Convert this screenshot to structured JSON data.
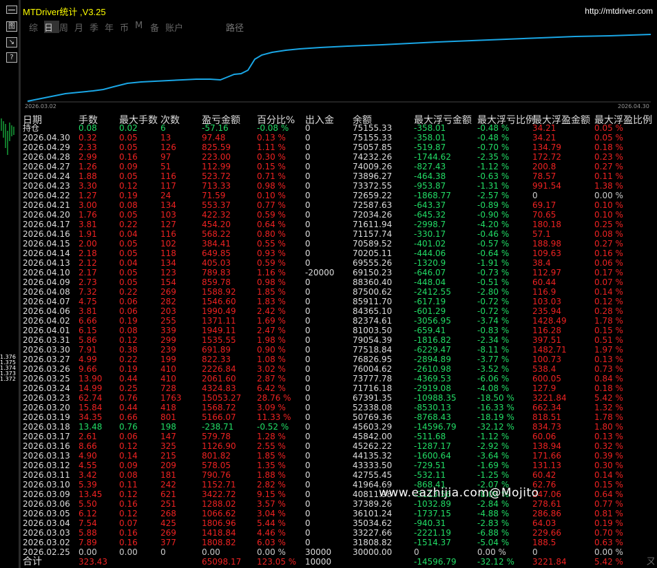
{
  "window": {
    "title": "MTDriver统计 ,V3.25",
    "url": "http://mtdriver.com"
  },
  "side_buttons": [
    "图",
    "↘",
    "?"
  ],
  "left_ticks": [
    "1.376",
    "1.375",
    "1.374",
    "1.373",
    "1.372"
  ],
  "tabs": [
    {
      "label": "综",
      "active": false
    },
    {
      "label": "日",
      "active": true
    },
    {
      "label": "周",
      "active": false
    },
    {
      "label": "月",
      "active": false
    },
    {
      "label": "季",
      "active": false
    },
    {
      "label": "年",
      "active": false
    },
    {
      "label": "币",
      "active": false
    },
    {
      "label": "M",
      "active": false
    },
    {
      "label": "备",
      "active": false
    },
    {
      "label": "账户",
      "active": false
    }
  ],
  "path_label": "路径",
  "curve": {
    "start_date": "2026.03.02",
    "end_date": "2026.04.30",
    "color": "#1aa7e6"
  },
  "headers": [
    "日期",
    "手数",
    "最大手数",
    "次数",
    "盈亏金额",
    "百分比%",
    "出入金",
    "余额",
    "最大浮亏金额",
    "最大浮亏比例",
    "最大浮盈金额",
    "最大浮盈比例"
  ],
  "rows": [
    {
      "date": "持仓",
      "lots": "0.08",
      "maxlots": "0.02",
      "trades": "6",
      "pnl": "-57.16",
      "pct": "-0.08 %",
      "io": "0",
      "bal": "75155.33",
      "fl": "-358.01",
      "flpct": "-0.48 %",
      "fp": "34.21",
      "fppct": "0.05 %"
    },
    {
      "date": "2026.04.30",
      "lots": "0.32",
      "maxlots": "0.05",
      "trades": "13",
      "pnl": "97.48",
      "pct": "0.13 %",
      "io": "0",
      "bal": "75155.33",
      "fl": "-358.01",
      "flpct": "-0.48 %",
      "fp": "34.21",
      "fppct": "0.05 %"
    },
    {
      "date": "2026.04.29",
      "lots": "2.33",
      "maxlots": "0.05",
      "trades": "126",
      "pnl": "825.59",
      "pct": "1.11 %",
      "io": "0",
      "bal": "75057.85",
      "fl": "-519.87",
      "flpct": "-0.70 %",
      "fp": "134.79",
      "fppct": "0.18 %"
    },
    {
      "date": "2026.04.28",
      "lots": "2.99",
      "maxlots": "0.16",
      "trades": "97",
      "pnl": "223.00",
      "pct": "0.30 %",
      "io": "0",
      "bal": "74232.26",
      "fl": "-1744.62",
      "flpct": "-2.35 %",
      "fp": "172.72",
      "fppct": "0.23 %"
    },
    {
      "date": "2026.04.27",
      "lots": "1.26",
      "maxlots": "0.09",
      "trades": "51",
      "pnl": "112.99",
      "pct": "0.15 %",
      "io": "0",
      "bal": "74009.26",
      "fl": "-827.43",
      "flpct": "-1.12 %",
      "fp": "200.8",
      "fppct": "0.27 %"
    },
    {
      "date": "2026.04.24",
      "lots": "1.88",
      "maxlots": "0.05",
      "trades": "116",
      "pnl": "523.72",
      "pct": "0.71 %",
      "io": "0",
      "bal": "73896.27",
      "fl": "-464.38",
      "flpct": "-0.63 %",
      "fp": "78.57",
      "fppct": "0.11 %"
    },
    {
      "date": "2026.04.23",
      "lots": "3.30",
      "maxlots": "0.12",
      "trades": "117",
      "pnl": "713.33",
      "pct": "0.98 %",
      "io": "0",
      "bal": "73372.55",
      "fl": "-953.87",
      "flpct": "-1.31 %",
      "fp": "991.54",
      "fppct": "1.38 %"
    },
    {
      "date": "2026.04.22",
      "lots": "1.27",
      "maxlots": "0.19",
      "trades": "24",
      "pnl": "71.59",
      "pct": "0.10 %",
      "io": "0",
      "bal": "72659.22",
      "fl": "-1868.77",
      "flpct": "-2.57 %",
      "fp": "0",
      "fppct": "0.00 %"
    },
    {
      "date": "2026.04.21",
      "lots": "3.00",
      "maxlots": "0.08",
      "trades": "134",
      "pnl": "553.37",
      "pct": "0.77 %",
      "io": "0",
      "bal": "72587.63",
      "fl": "-643.37",
      "flpct": "-0.89 %",
      "fp": "69.17",
      "fppct": "0.10 %"
    },
    {
      "date": "2026.04.20",
      "lots": "1.76",
      "maxlots": "0.05",
      "trades": "103",
      "pnl": "422.32",
      "pct": "0.59 %",
      "io": "0",
      "bal": "72034.26",
      "fl": "-645.32",
      "flpct": "-0.90 %",
      "fp": "70.65",
      "fppct": "0.10 %"
    },
    {
      "date": "2026.04.17",
      "lots": "3.81",
      "maxlots": "0.22",
      "trades": "127",
      "pnl": "454.20",
      "pct": "0.64 %",
      "io": "0",
      "bal": "71611.94",
      "fl": "-2998.7",
      "flpct": "-4.20 %",
      "fp": "180.18",
      "fppct": "0.25 %"
    },
    {
      "date": "2026.04.16",
      "lots": "1.91",
      "maxlots": "0.04",
      "trades": "116",
      "pnl": "568.22",
      "pct": "0.80 %",
      "io": "0",
      "bal": "71157.74",
      "fl": "-330.17",
      "flpct": "-0.46 %",
      "fp": "57.1",
      "fppct": "0.08 %"
    },
    {
      "date": "2026.04.15",
      "lots": "2.00",
      "maxlots": "0.05",
      "trades": "102",
      "pnl": "384.41",
      "pct": "0.55 %",
      "io": "0",
      "bal": "70589.52",
      "fl": "-401.02",
      "flpct": "-0.57 %",
      "fp": "188.98",
      "fppct": "0.27 %"
    },
    {
      "date": "2026.04.14",
      "lots": "2.18",
      "maxlots": "0.05",
      "trades": "118",
      "pnl": "649.85",
      "pct": "0.93 %",
      "io": "0",
      "bal": "70205.11",
      "fl": "-444.06",
      "flpct": "-0.64 %",
      "fp": "109.63",
      "fppct": "0.16 %"
    },
    {
      "date": "2026.04.13",
      "lots": "2.12",
      "maxlots": "0.04",
      "trades": "134",
      "pnl": "405.03",
      "pct": "0.59 %",
      "io": "0",
      "bal": "69555.26",
      "fl": "-1320.9",
      "flpct": "-1.91 %",
      "fp": "38.4",
      "fppct": "0.06 %"
    },
    {
      "date": "2026.04.10",
      "lots": "2.17",
      "maxlots": "0.05",
      "trades": "123",
      "pnl": "789.83",
      "pct": "1.16 %",
      "io": "-20000",
      "bal": "69150.23",
      "fl": "-646.07",
      "flpct": "-0.73 %",
      "fp": "112.97",
      "fppct": "0.17 %"
    },
    {
      "date": "2026.04.09",
      "lots": "2.73",
      "maxlots": "0.05",
      "trades": "154",
      "pnl": "859.78",
      "pct": "0.98 %",
      "io": "0",
      "bal": "88360.40",
      "fl": "-448.04",
      "flpct": "-0.51 %",
      "fp": "60.44",
      "fppct": "0.07 %"
    },
    {
      "date": "2026.04.08",
      "lots": "7.32",
      "maxlots": "0.22",
      "trades": "269",
      "pnl": "1588.92",
      "pct": "1.85 %",
      "io": "0",
      "bal": "87500.62",
      "fl": "-2412.55",
      "flpct": "-2.80 %",
      "fp": "116.9",
      "fppct": "0.14 %"
    },
    {
      "date": "2026.04.07",
      "lots": "4.75",
      "maxlots": "0.06",
      "trades": "282",
      "pnl": "1546.60",
      "pct": "1.83 %",
      "io": "0",
      "bal": "85911.70",
      "fl": "-617.19",
      "flpct": "-0.72 %",
      "fp": "103.03",
      "fppct": "0.12 %"
    },
    {
      "date": "2026.04.06",
      "lots": "3.81",
      "maxlots": "0.06",
      "trades": "203",
      "pnl": "1990.49",
      "pct": "2.42 %",
      "io": "0",
      "bal": "84365.10",
      "fl": "-601.29",
      "flpct": "-0.72 %",
      "fp": "235.94",
      "fppct": "0.28 %"
    },
    {
      "date": "2026.04.02",
      "lots": "6.66",
      "maxlots": "0.19",
      "trades": "255",
      "pnl": "1371.11",
      "pct": "1.69 %",
      "io": "0",
      "bal": "82374.61",
      "fl": "-3056.95",
      "flpct": "-3.74 %",
      "fp": "1428.49",
      "fppct": "1.78 %"
    },
    {
      "date": "2026.04.01",
      "lots": "6.15",
      "maxlots": "0.08",
      "trades": "339",
      "pnl": "1949.11",
      "pct": "2.47 %",
      "io": "0",
      "bal": "81003.50",
      "fl": "-659.41",
      "flpct": "-0.83 %",
      "fp": "116.28",
      "fppct": "0.15 %"
    },
    {
      "date": "2026.03.31",
      "lots": "5.86",
      "maxlots": "0.12",
      "trades": "299",
      "pnl": "1535.55",
      "pct": "1.98 %",
      "io": "0",
      "bal": "79054.39",
      "fl": "-1816.82",
      "flpct": "-2.34 %",
      "fp": "397.51",
      "fppct": "0.51 %"
    },
    {
      "date": "2026.03.30",
      "lots": "7.91",
      "maxlots": "0.38",
      "trades": "239",
      "pnl": "691.89",
      "pct": "0.90 %",
      "io": "0",
      "bal": "77518.84",
      "fl": "-6229.47",
      "flpct": "-8.11 %",
      "fp": "1482.71",
      "fppct": "1.97 %"
    },
    {
      "date": "2026.03.27",
      "lots": "4.99",
      "maxlots": "0.22",
      "trades": "199",
      "pnl": "822.33",
      "pct": "1.08 %",
      "io": "0",
      "bal": "76826.95",
      "fl": "-2894.89",
      "flpct": "-3.77 %",
      "fp": "100.73",
      "fppct": "0.13 %"
    },
    {
      "date": "2026.03.26",
      "lots": "9.66",
      "maxlots": "0.19",
      "trades": "410",
      "pnl": "2226.84",
      "pct": "3.02 %",
      "io": "0",
      "bal": "76004.62",
      "fl": "-2610.98",
      "flpct": "-3.52 %",
      "fp": "538.4",
      "fppct": "0.73 %"
    },
    {
      "date": "2026.03.25",
      "lots": "13.90",
      "maxlots": "0.44",
      "trades": "410",
      "pnl": "2061.60",
      "pct": "2.87 %",
      "io": "0",
      "bal": "73777.78",
      "fl": "-4369.53",
      "flpct": "-6.06 %",
      "fp": "600.05",
      "fppct": "0.84 %"
    },
    {
      "date": "2026.03.24",
      "lots": "14.99",
      "maxlots": "0.25",
      "trades": "728",
      "pnl": "4324.83",
      "pct": "6.42 %",
      "io": "0",
      "bal": "71716.18",
      "fl": "-2919.08",
      "flpct": "-4.08 %",
      "fp": "127.9",
      "fppct": "0.18 %"
    },
    {
      "date": "2026.03.23",
      "lots": "62.74",
      "maxlots": "0.76",
      "trades": "1763",
      "pnl": "15053.27",
      "pct": "28.76 %",
      "io": "0",
      "bal": "67391.35",
      "fl": "-10988.35",
      "flpct": "-18.50 %",
      "fp": "3221.84",
      "fppct": "5.42 %"
    },
    {
      "date": "2026.03.20",
      "lots": "15.84",
      "maxlots": "0.44",
      "trades": "418",
      "pnl": "1568.72",
      "pct": "3.09 %",
      "io": "0",
      "bal": "52338.08",
      "fl": "-8530.13",
      "flpct": "-16.33 %",
      "fp": "662.34",
      "fppct": "1.32 %"
    },
    {
      "date": "2026.03.19",
      "lots": "34.35",
      "maxlots": "0.66",
      "trades": "801",
      "pnl": "5166.07",
      "pct": "11.33 %",
      "io": "0",
      "bal": "50769.36",
      "fl": "-8768.43",
      "flpct": "-18.19 %",
      "fp": "818.51",
      "fppct": "1.78 %"
    },
    {
      "date": "2026.03.18",
      "lots": "13.48",
      "maxlots": "0.76",
      "trades": "198",
      "pnl": "-238.71",
      "pct": "-0.52 %",
      "io": "0",
      "bal": "45603.29",
      "fl": "-14596.79",
      "flpct": "-32.12 %",
      "fp": "834.73",
      "fppct": "1.80 %"
    },
    {
      "date": "2026.03.17",
      "lots": "2.61",
      "maxlots": "0.06",
      "trades": "147",
      "pnl": "579.78",
      "pct": "1.28 %",
      "io": "0",
      "bal": "45842.00",
      "fl": "-511.68",
      "flpct": "-1.12 %",
      "fp": "60.06",
      "fppct": "0.13 %"
    },
    {
      "date": "2026.03.16",
      "lots": "8.66",
      "maxlots": "0.12",
      "trades": "325",
      "pnl": "1126.90",
      "pct": "2.55 %",
      "io": "0",
      "bal": "45262.22",
      "fl": "-1287.17",
      "flpct": "-2.92 %",
      "fp": "138.94",
      "fppct": "0.32 %"
    },
    {
      "date": "2026.03.13",
      "lots": "4.90",
      "maxlots": "0.14",
      "trades": "215",
      "pnl": "801.82",
      "pct": "1.85 %",
      "io": "0",
      "bal": "44135.32",
      "fl": "-1600.64",
      "flpct": "-3.64 %",
      "fp": "171.66",
      "fppct": "0.39 %"
    },
    {
      "date": "2026.03.12",
      "lots": "4.55",
      "maxlots": "0.09",
      "trades": "209",
      "pnl": "578.05",
      "pct": "1.35 %",
      "io": "0",
      "bal": "43333.50",
      "fl": "-729.51",
      "flpct": "-1.69 %",
      "fp": "131.13",
      "fppct": "0.30 %"
    },
    {
      "date": "2026.03.11",
      "lots": "3.42",
      "maxlots": "0.08",
      "trades": "181",
      "pnl": "790.76",
      "pct": "1.88 %",
      "io": "0",
      "bal": "42755.45",
      "fl": "-532.11",
      "flpct": "-1.25 %",
      "fp": "60.42",
      "fppct": "0.14 %"
    },
    {
      "date": "2026.03.10",
      "lots": "5.39",
      "maxlots": "0.11",
      "trades": "242",
      "pnl": "1152.71",
      "pct": "2.82 %",
      "io": "0",
      "bal": "41964.69",
      "fl": "-868.41",
      "flpct": "-2.07 %",
      "fp": "62.76",
      "fppct": "0.15 %"
    },
    {
      "date": "2026.03.09",
      "lots": "13.45",
      "maxlots": "0.12",
      "trades": "621",
      "pnl": "3422.72",
      "pct": "9.15 %",
      "io": "0",
      "bal": "40811.98",
      "fl": "-3113.56",
      "flpct": "-8.08 %",
      "fp": "247.06",
      "fppct": "0.64 %"
    },
    {
      "date": "2026.03.06",
      "lots": "5.50",
      "maxlots": "0.16",
      "trades": "251",
      "pnl": "1288.02",
      "pct": "3.57 %",
      "io": "0",
      "bal": "37389.26",
      "fl": "-1032.89",
      "flpct": "-2.84 %",
      "fp": "278.61",
      "fppct": "0.77 %"
    },
    {
      "date": "2026.03.05",
      "lots": "6.12",
      "maxlots": "0.12",
      "trades": "268",
      "pnl": "1066.62",
      "pct": "3.04 %",
      "io": "0",
      "bal": "36101.24",
      "fl": "-1737.15",
      "flpct": "-4.88 %",
      "fp": "286.86",
      "fppct": "0.81 %"
    },
    {
      "date": "2026.03.04",
      "lots": "7.54",
      "maxlots": "0.07",
      "trades": "425",
      "pnl": "1806.96",
      "pct": "5.44 %",
      "io": "0",
      "bal": "35034.62",
      "fl": "-940.31",
      "flpct": "-2.83 %",
      "fp": "64.03",
      "fppct": "0.19 %"
    },
    {
      "date": "2026.03.03",
      "lots": "5.88",
      "maxlots": "0.16",
      "trades": "269",
      "pnl": "1418.84",
      "pct": "4.46 %",
      "io": "0",
      "bal": "33227.66",
      "fl": "-2221.19",
      "flpct": "-6.88 %",
      "fp": "229.66",
      "fppct": "0.70 %"
    },
    {
      "date": "2026.03.02",
      "lots": "7.89",
      "maxlots": "0.16",
      "trades": "377",
      "pnl": "1808.82",
      "pct": "6.03 %",
      "io": "0",
      "bal": "31808.82",
      "fl": "-1514.37",
      "flpct": "-5.04 %",
      "fp": "188.5",
      "fppct": "0.63 %"
    },
    {
      "date": "2026.02.25",
      "lots": "0.00",
      "maxlots": "0.00",
      "trades": "0",
      "pnl": "0.00",
      "pct": "0.00 %",
      "io": "30000",
      "bal": "30000.00",
      "fl": "0",
      "flpct": "0.00 %",
      "fp": "0",
      "fppct": "0.00 %"
    }
  ],
  "total": {
    "date": "合计",
    "lots": "323.43",
    "maxlots": "",
    "trades": "",
    "pnl": "65098.17",
    "pct": "123.05 %",
    "io": "10000",
    "bal": "",
    "fl": "-14596.79",
    "flpct": "-32.12 %",
    "fp": "3221.84",
    "fppct": "5.42 %"
  },
  "watermark": "www.eazhijia.com@Mojito",
  "corner_text": "ㄡ"
}
